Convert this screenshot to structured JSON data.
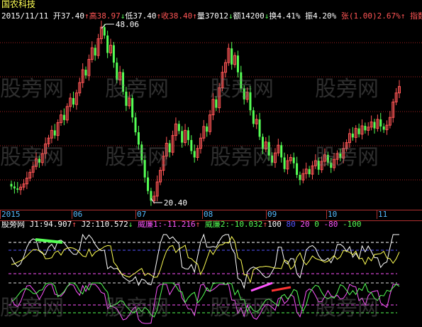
{
  "app": {
    "title": "国农科技"
  },
  "quote": [
    {
      "text": "2015/11/11",
      "color": "#ffffff"
    },
    {
      "text": " 开37.40",
      "color": "#ffffff"
    },
    {
      "text": "↑",
      "color": "#ff5555"
    },
    {
      "text": "高38.97",
      "color": "#ff5555"
    },
    {
      "text": "↓",
      "color": "#55ff55"
    },
    {
      "text": "低37.40",
      "color": "#ffffff"
    },
    {
      "text": "↑",
      "color": "#ff5555"
    },
    {
      "text": "收38.40",
      "color": "#ff5555"
    },
    {
      "text": "↑",
      "color": "#ff5555"
    },
    {
      "text": "量37012",
      "color": "#ffffff"
    },
    {
      "text": "↓",
      "color": "#55ff55"
    },
    {
      "text": "额14200",
      "color": "#ffffff"
    },
    {
      "text": "↓",
      "color": "#55ff55"
    },
    {
      "text": "换4.41%",
      "color": "#ffffff"
    },
    {
      "text": " 振4.20%",
      "color": "#ffffff"
    },
    {
      "text": " 张(1.00)2.67%",
      "color": "#ff5555"
    },
    {
      "text": "↑",
      "color": "#ff5555"
    },
    {
      "text": " 指数",
      "color": "#ff5555"
    }
  ],
  "indicator": [
    {
      "text": "股旁网",
      "color": "#ffffff"
    },
    {
      "text": " J1:94.907",
      "color": "#ffffff"
    },
    {
      "text": "↑",
      "color": "#ff5555"
    },
    {
      "text": " J2:110.572",
      "color": "#ffffff"
    },
    {
      "text": "↓",
      "color": "#55ff55"
    },
    {
      "text": " 威廉1:-11.216",
      "color": "#ff55ff"
    },
    {
      "text": "↑",
      "color": "#ff5555"
    },
    {
      "text": " 威廉2:-10.032",
      "color": "#55ff55"
    },
    {
      "text": "↑",
      "color": "#ff5555"
    },
    {
      "text": "100",
      "color": "#ffffff"
    },
    {
      "text": " 80",
      "color": "#5555ff"
    },
    {
      "text": " 20",
      "color": "#ff55ff"
    },
    {
      "text": " 0",
      "color": "#55ff55"
    },
    {
      "text": " -80",
      "color": "#ff55ff"
    },
    {
      "text": " -100",
      "color": "#55ff55"
    }
  ],
  "price_labels": {
    "high": "48.06",
    "low": "20.40"
  },
  "months": [
    "2015",
    "06",
    "07",
    "08",
    "09",
    "10",
    "11"
  ],
  "watermark": "股旁网",
  "colors": {
    "up": "#ff5555",
    "down": "#55ff55",
    "grid": "#a02020",
    "j1": "#ffffff",
    "j2": "#ffff55",
    "will1": "#ff55ff",
    "will2": "#55ff55"
  },
  "chart_data": {
    "type": "candlestick",
    "price_range": [
      20.4,
      48.06
    ],
    "closes": [
      22.9,
      22.6,
      22.4,
      22.8,
      23.3,
      24.2,
      25.1,
      26.0,
      27.2,
      26.6,
      28.0,
      29.5,
      30.4,
      31.6,
      30.8,
      32.8,
      34.0,
      33.2,
      35.3,
      36.6,
      35.6,
      37.4,
      39.0,
      41.0,
      40.1,
      42.6,
      44.4,
      43.2,
      45.8,
      47.6,
      46.3,
      43.6,
      44.8,
      42.1,
      39.4,
      40.6,
      37.6,
      35.4,
      36.6,
      33.6,
      31.3,
      29.4,
      27.0,
      24.3,
      22.2,
      20.7,
      21.4,
      23.6,
      25.4,
      27.6,
      29.6,
      28.2,
      30.8,
      32.6,
      31.5,
      29.7,
      31.6,
      30.1,
      28.4,
      27.4,
      28.8,
      30.4,
      32.2,
      31.4,
      34.0,
      36.4,
      35.1,
      38.2,
      40.6,
      42.1,
      44.3,
      41.8,
      43.2,
      40.6,
      38.1,
      36.4,
      37.5,
      34.7,
      32.6,
      33.3,
      30.6,
      28.7,
      29.8,
      27.7,
      26.6,
      28.1,
      29.3,
      27.4,
      25.6,
      26.9,
      27.4,
      26.5,
      24.7,
      23.9,
      24.9,
      25.6,
      24.8,
      26.1,
      26.9,
      25.5,
      26.8,
      27.8,
      26.6,
      25.8,
      27.1,
      28.0,
      27.3,
      28.8,
      29.7,
      31.1,
      30.5,
      31.9,
      31.0,
      32.3,
      31.6,
      32.1,
      32.9,
      31.9,
      33.3,
      32.2,
      31.7,
      32.4,
      33.6,
      36.0,
      37.4,
      38.4
    ]
  }
}
